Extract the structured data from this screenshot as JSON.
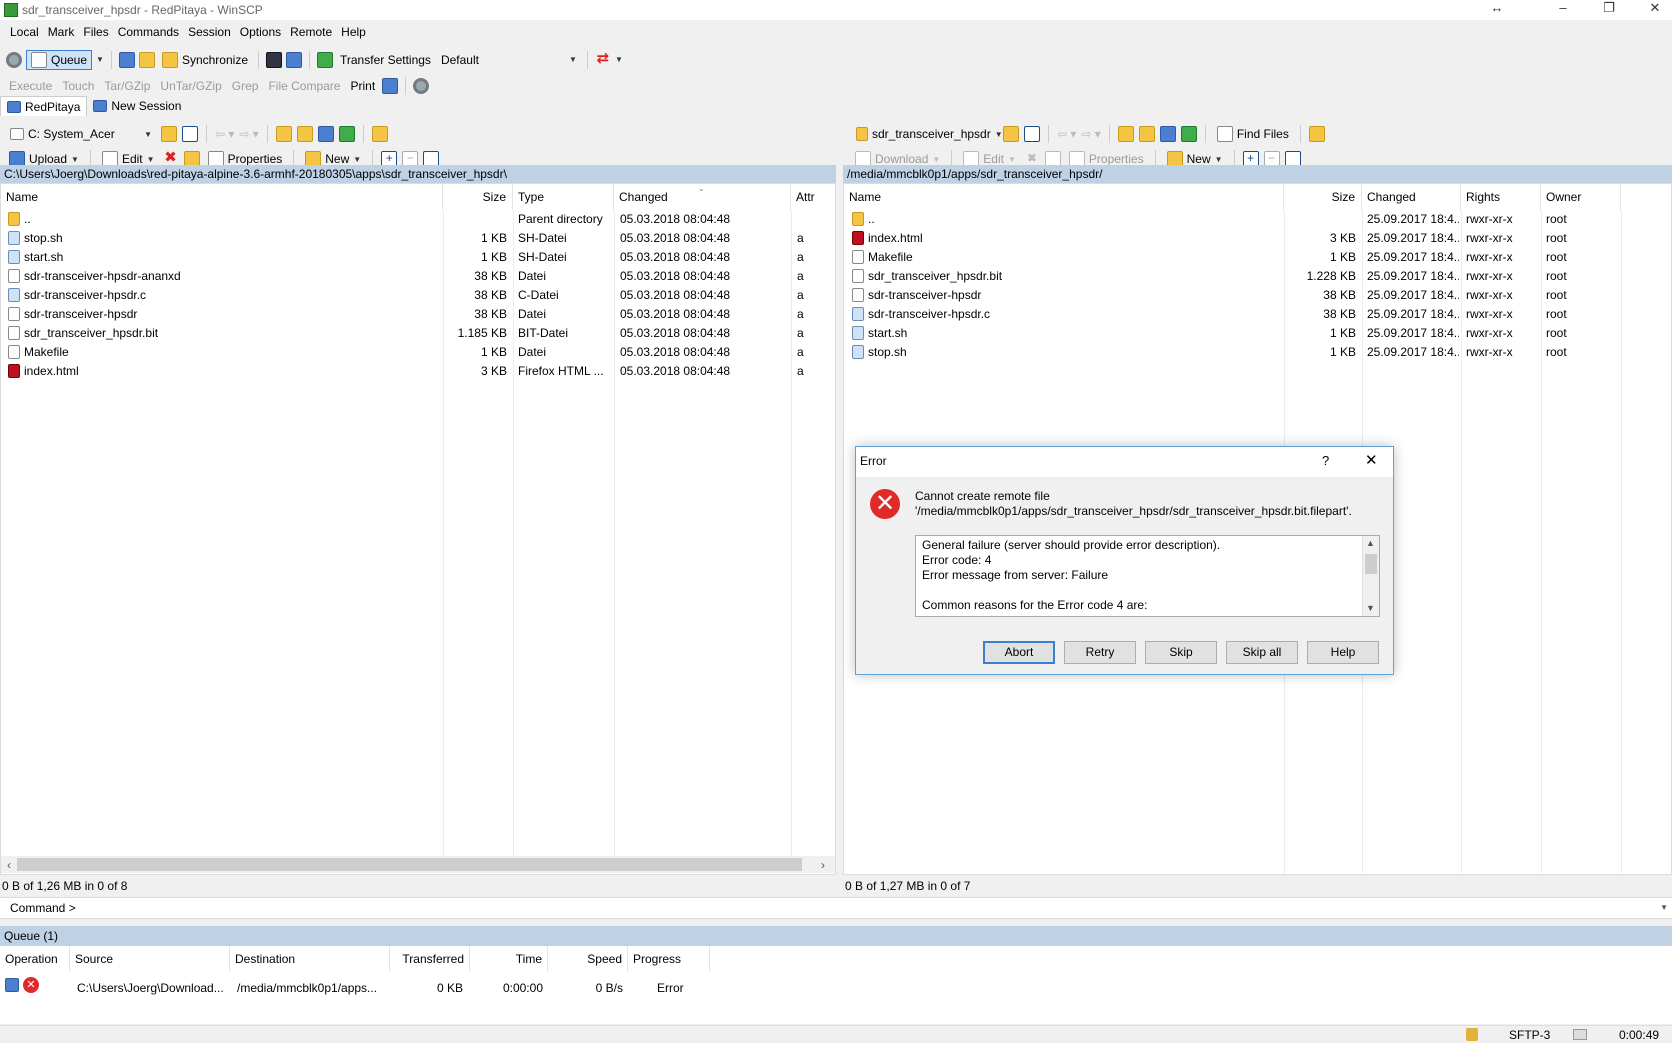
{
  "window": {
    "title": "sdr_transceiver_hpsdr - RedPitaya - WinSCP"
  },
  "menu": [
    "Local",
    "Mark",
    "Files",
    "Commands",
    "Session",
    "Options",
    "Remote",
    "Help"
  ],
  "toolbar1": {
    "queue": "Queue",
    "synchronize": "Synchronize",
    "transfer_settings": "Transfer Settings",
    "transfer_preset": "Default"
  },
  "toolbar2": [
    "Execute",
    "Touch",
    "Tar/GZip",
    "UnTar/GZip",
    "Grep",
    "File Compare",
    "Print"
  ],
  "tabs": {
    "session": "RedPitaya",
    "new_session": "New Session"
  },
  "left": {
    "drive": "C: System_Acer",
    "actions": {
      "upload": "Upload",
      "edit": "Edit",
      "properties": "Properties",
      "new": "New"
    },
    "path": "C:\\Users\\Joerg\\Downloads\\red-pitaya-alpine-3.6-armhf-20180305\\apps\\sdr_transceiver_hpsdr\\",
    "columns": {
      "name": "Name",
      "size": "Size",
      "type": "Type",
      "changed": "Changed",
      "attr": "Attr"
    },
    "files": [
      {
        "name": "..",
        "size": "",
        "type": "Parent directory",
        "changed": "05.03.2018  08:04:48",
        "attr": "",
        "icon": "parent-folder-icon"
      },
      {
        "name": "stop.sh",
        "size": "1 KB",
        "type": "SH-Datei",
        "changed": "05.03.2018  08:04:48",
        "attr": "a",
        "icon": "script-file-icon"
      },
      {
        "name": "start.sh",
        "size": "1 KB",
        "type": "SH-Datei",
        "changed": "05.03.2018  08:04:48",
        "attr": "a",
        "icon": "script-file-icon"
      },
      {
        "name": "sdr-transceiver-hpsdr-ananxd",
        "size": "38 KB",
        "type": "Datei",
        "changed": "05.03.2018  08:04:48",
        "attr": "a",
        "icon": "file-icon"
      },
      {
        "name": "sdr-transceiver-hpsdr.c",
        "size": "38 KB",
        "type": "C-Datei",
        "changed": "05.03.2018  08:04:48",
        "attr": "a",
        "icon": "script-file-icon"
      },
      {
        "name": "sdr-transceiver-hpsdr",
        "size": "38 KB",
        "type": "Datei",
        "changed": "05.03.2018  08:04:48",
        "attr": "a",
        "icon": "file-icon"
      },
      {
        "name": "sdr_transceiver_hpsdr.bit",
        "size": "1.185 KB",
        "type": "BIT-Datei",
        "changed": "05.03.2018  08:04:48",
        "attr": "a",
        "icon": "file-icon"
      },
      {
        "name": "Makefile",
        "size": "1 KB",
        "type": "Datei",
        "changed": "05.03.2018  08:04:48",
        "attr": "a",
        "icon": "file-icon"
      },
      {
        "name": "index.html",
        "size": "3 KB",
        "type": "Firefox HTML ...",
        "changed": "05.03.2018  08:04:48",
        "attr": "a",
        "icon": "html-file-icon"
      }
    ],
    "status": "0 B of 1,26 MB in 0 of 8"
  },
  "right": {
    "folder": "sdr_transceiver_hpsdr",
    "find_files": "Find Files",
    "actions": {
      "download": "Download",
      "edit": "Edit",
      "properties": "Properties",
      "new": "New"
    },
    "path": "/media/mmcblk0p1/apps/sdr_transceiver_hpsdr/",
    "columns": {
      "name": "Name",
      "size": "Size",
      "changed": "Changed",
      "rights": "Rights",
      "owner": "Owner"
    },
    "files": [
      {
        "name": "..",
        "size": "",
        "changed": "25.09.2017 18:4...",
        "rights": "rwxr-xr-x",
        "owner": "root",
        "icon": "parent-folder-icon"
      },
      {
        "name": "index.html",
        "size": "3 KB",
        "changed": "25.09.2017 18:4...",
        "rights": "rwxr-xr-x",
        "owner": "root",
        "icon": "html-file-icon"
      },
      {
        "name": "Makefile",
        "size": "1 KB",
        "changed": "25.09.2017 18:4...",
        "rights": "rwxr-xr-x",
        "owner": "root",
        "icon": "file-icon"
      },
      {
        "name": "sdr_transceiver_hpsdr.bit",
        "size": "1.228 KB",
        "changed": "25.09.2017 18:4...",
        "rights": "rwxr-xr-x",
        "owner": "root",
        "icon": "file-icon"
      },
      {
        "name": "sdr-transceiver-hpsdr",
        "size": "38 KB",
        "changed": "25.09.2017 18:4...",
        "rights": "rwxr-xr-x",
        "owner": "root",
        "icon": "file-icon"
      },
      {
        "name": "sdr-transceiver-hpsdr.c",
        "size": "38 KB",
        "changed": "25.09.2017 18:4...",
        "rights": "rwxr-xr-x",
        "owner": "root",
        "icon": "script-file-icon"
      },
      {
        "name": "start.sh",
        "size": "1 KB",
        "changed": "25.09.2017 18:4...",
        "rights": "rwxr-xr-x",
        "owner": "root",
        "icon": "script-file-icon"
      },
      {
        "name": "stop.sh",
        "size": "1 KB",
        "changed": "25.09.2017 18:4...",
        "rights": "rwxr-xr-x",
        "owner": "root",
        "icon": "script-file-icon"
      }
    ],
    "status": "0 B of 1,27 MB in 0 of 7"
  },
  "command": {
    "prompt": "Command >"
  },
  "queue": {
    "header": "Queue (1)",
    "columns": {
      "operation": "Operation",
      "source": "Source",
      "destination": "Destination",
      "transferred": "Transferred",
      "time": "Time",
      "speed": "Speed",
      "progress": "Progress"
    },
    "item": {
      "source": "C:\\Users\\Joerg\\Download...",
      "destination": "/media/mmcblk0p1/apps...",
      "transferred": "0 KB",
      "time": "0:00:00",
      "speed": "0 B/s",
      "progress": "Error"
    }
  },
  "statusbar": {
    "protocol": "SFTP-3",
    "time": "0:00:49"
  },
  "dialog": {
    "title": "Error",
    "help_glyph": "?",
    "message_line1": "Cannot create remote file",
    "message_line2": "'/media/mmcblk0p1/apps/sdr_transceiver_hpsdr/sdr_transceiver_hpsdr.bit.filepart'.",
    "details": [
      "General failure (server should provide error description).",
      "Error code: 4",
      "Error message from server: Failure",
      "",
      "Common reasons for the Error code 4 are:"
    ],
    "buttons": {
      "abort": "Abort",
      "retry": "Retry",
      "skip": "Skip",
      "skip_all": "Skip all",
      "help": "Help"
    }
  },
  "colors": {
    "path_bar": "#bfd1e5",
    "dialog_border": "#5ea2d8",
    "error_red": "#e02a2a",
    "default_button": "#3c7fd1"
  }
}
